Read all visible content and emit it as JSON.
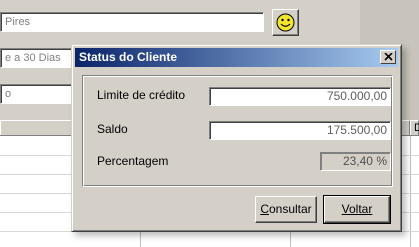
{
  "background": {
    "name_field_value": "Pires",
    "terms_field_value": "e a 30 Dias",
    "third_field_value": "o",
    "grid_header_partial": "D",
    "smiley_icon": "smiley-face-icon",
    "smiley_color": "#f2e52c"
  },
  "dialog": {
    "title": "Status do Cliente",
    "close_icon": "close-x-icon",
    "fields": {
      "credit_limit": {
        "label": "Limite de crédito",
        "value": "750.000,00"
      },
      "balance": {
        "label": "Saldo",
        "value": "175.500,00"
      },
      "percentage": {
        "label": "Percentagem",
        "value": "23,40 %"
      }
    },
    "buttons": {
      "consult": {
        "accel": "C",
        "rest": "onsultar"
      },
      "back": {
        "accel": "V",
        "rest": "oltar"
      }
    }
  },
  "colors": {
    "title_gradient_start": "#0a246a",
    "title_gradient_end": "#a6caf0",
    "face": "#d4d0c8"
  }
}
